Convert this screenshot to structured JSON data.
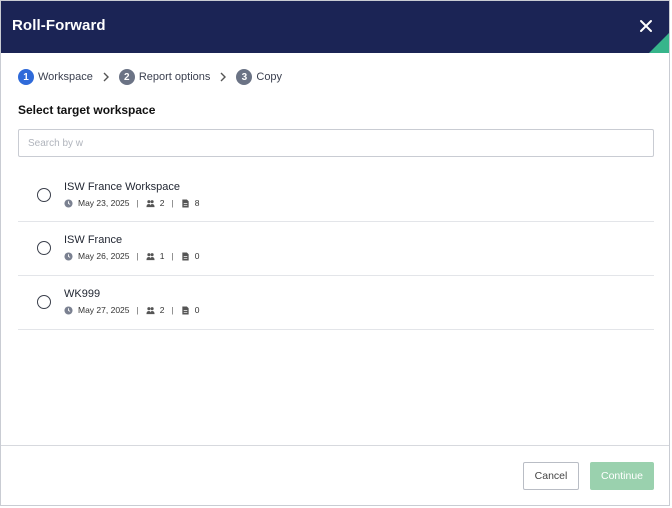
{
  "dialog": {
    "title": "Roll-Forward",
    "close_icon": "close-icon"
  },
  "stepper": [
    {
      "number": "1",
      "label": "Workspace",
      "state": "active"
    },
    {
      "number": "2",
      "label": "Report options",
      "state": "inactive"
    },
    {
      "number": "3",
      "label": "Copy",
      "state": "inactive"
    }
  ],
  "section": {
    "title": "Select target workspace"
  },
  "search": {
    "placeholder": "Search by w",
    "value": ""
  },
  "workspaces": [
    {
      "name": "ISW France Workspace",
      "date": "May 23, 2025",
      "users": "2",
      "documents": "8"
    },
    {
      "name": "ISW France",
      "date": "May 26, 2025",
      "users": "1",
      "documents": "0"
    },
    {
      "name": "WK999",
      "date": "May 27, 2025",
      "users": "2",
      "documents": "0"
    }
  ],
  "meta_separator": "|",
  "footer": {
    "cancel_label": "Cancel",
    "continue_label": "Continue"
  },
  "colors": {
    "header_bg": "#1b2455",
    "step_active": "#2f6ad9",
    "continue_disabled": "#9ad1ae",
    "accent_corner": "#37b58b"
  }
}
